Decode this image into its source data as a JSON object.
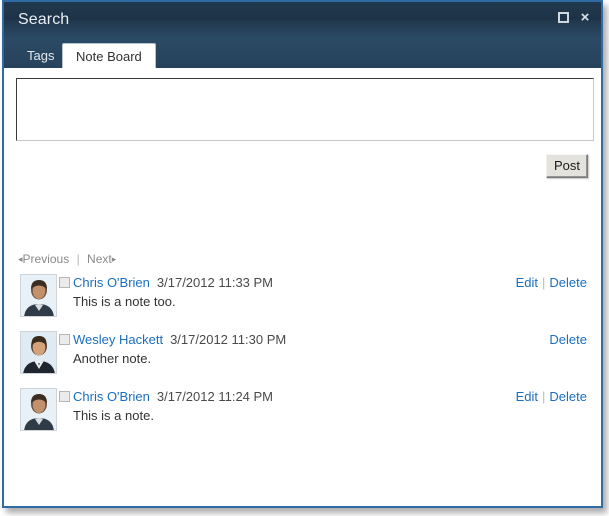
{
  "window": {
    "title": "Search",
    "controls": [
      {
        "name": "restore-button",
        "icon": "restore-icon",
        "label": ""
      },
      {
        "name": "close-button",
        "icon": "close-icon",
        "label": "×"
      }
    ],
    "accent_color": "#2e6ca3",
    "titlebar_color": "#1d3246"
  },
  "tabs": [
    {
      "label": "Tags",
      "active": false
    },
    {
      "label": "Note Board",
      "active": true
    }
  ],
  "composer": {
    "textarea_value": "",
    "textarea_placeholder": "",
    "post_label": "Post"
  },
  "paging": {
    "previous_arrow": "◂",
    "previous_label": "Previous",
    "separator": "|",
    "next_label": "Next",
    "next_arrow": "▸"
  },
  "notes": [
    {
      "user": "Chris O'Brien",
      "timestamp": "3/17/2012 11:33 PM",
      "text": "This is a note too.",
      "edit_label": "Edit",
      "action_separator": "|",
      "delete_label": "Delete",
      "can_edit": true
    },
    {
      "user": "Wesley Hackett",
      "timestamp": "3/17/2012 11:30 PM",
      "text": "Another note.",
      "edit_label": "",
      "action_separator": "",
      "delete_label": "Delete",
      "can_edit": false
    },
    {
      "user": "Chris O'Brien",
      "timestamp": "3/17/2012 11:24 PM",
      "text": "This is a note.",
      "edit_label": "Edit",
      "action_separator": "|",
      "delete_label": "Delete",
      "can_edit": true
    }
  ],
  "colors": {
    "link": "#1a6ec0",
    "muted": "#8a8a8a",
    "body_text": "#333333"
  }
}
